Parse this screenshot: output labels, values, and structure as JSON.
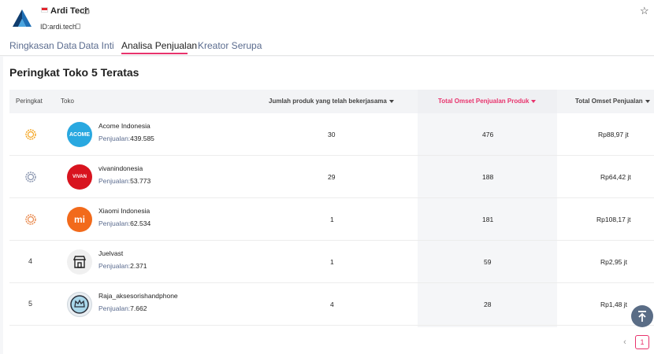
{
  "shop": {
    "name": "Ardi Tech",
    "id_label": "ID:",
    "id_value": "ardi.tech"
  },
  "tabs": [
    {
      "label": "Ringkasan Data"
    },
    {
      "label": "Data Inti"
    },
    {
      "label": "Analisa Penjualan"
    },
    {
      "label": "Kreator Serupa"
    }
  ],
  "section": {
    "title": "Peringkat Toko 5 Teratas"
  },
  "table": {
    "headers": {
      "rank": "Peringkat",
      "shop": "Toko",
      "products": "Jumlah produk yang telah bekerjasama",
      "product_gmv": "Total Omset Penjualan Produk",
      "total_gmv": "Total Omset Penjualan"
    },
    "sales_label": "Penjualan:",
    "rows": [
      {
        "rank": "",
        "medal": "gold",
        "shop_name": "Acome Indonesia",
        "sales": "439.585",
        "products": "30",
        "product_gmv": "476",
        "total_gmv": "Rp88,97 jt",
        "avatar_text": "ACOME"
      },
      {
        "rank": "",
        "medal": "silver",
        "shop_name": "vivanindonesia",
        "sales": "53.773",
        "products": "29",
        "product_gmv": "188",
        "total_gmv": "Rp64,42 jt",
        "avatar_text": "VIVAN"
      },
      {
        "rank": "",
        "medal": "bronze",
        "shop_name": "Xiaomi Indonesia",
        "sales": "62.534",
        "products": "1",
        "product_gmv": "181",
        "total_gmv": "Rp108,17 jt",
        "avatar_text": "mi"
      },
      {
        "rank": "4",
        "medal": "",
        "shop_name": "Juelvast",
        "sales": "2.371",
        "products": "1",
        "product_gmv": "59",
        "total_gmv": "Rp2,95 jt",
        "avatar_text": ""
      },
      {
        "rank": "5",
        "medal": "",
        "shop_name": "Raja_aksesorishandphone",
        "sales": "7.662",
        "products": "4",
        "product_gmv": "28",
        "total_gmv": "Rp1,48 jt",
        "avatar_text": ""
      }
    ]
  },
  "pagination": {
    "prev": "‹",
    "current": "1"
  },
  "colors": {
    "accent": "#e8336d",
    "link": "#5b6c8f",
    "gold": "#f5a623",
    "silver": "#8a96b0",
    "bronze": "#e98a4e"
  },
  "icons": {
    "star": "star-outline-icon",
    "copy": "copy-icon",
    "scroll_top": "arrow-up-to-top-icon"
  }
}
